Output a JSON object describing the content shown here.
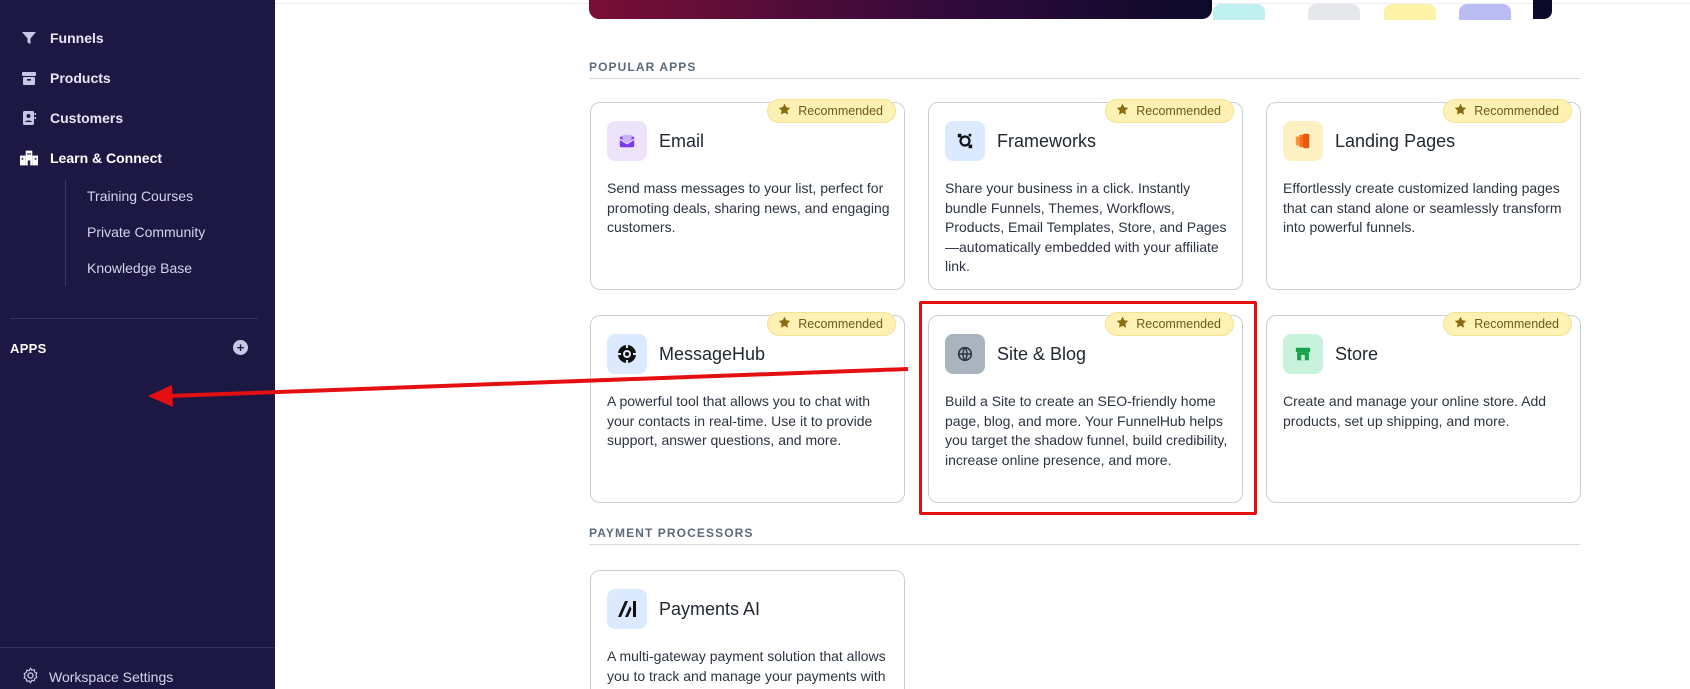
{
  "sidebar": {
    "nav": [
      {
        "label": "Funnels",
        "icon": "funnel-icon"
      },
      {
        "label": "Products",
        "icon": "box-icon"
      },
      {
        "label": "Customers",
        "icon": "contact-card-icon"
      },
      {
        "label": "Learn & Connect",
        "icon": "buildings-icon"
      }
    ],
    "sub_items": [
      "Training Courses",
      "Private Community",
      "Knowledge Base"
    ],
    "apps_label": "APPS",
    "settings_label": "Workspace Settings"
  },
  "sections": {
    "popular_title": "POPULAR APPS",
    "payment_title": "PAYMENT PROCESSORS"
  },
  "badge_label": "Recommended",
  "apps": [
    {
      "name": "Email",
      "desc": "Send mass messages to your list, perfect for promoting deals, sharing news, and engaging customers.",
      "icon": "email-icon",
      "icon_bg": "#ede4fb",
      "icon_color": "#7c3aed",
      "recommended": true
    },
    {
      "name": "Frameworks",
      "desc": "Share your business in a click. Instantly bundle Funnels, Themes, Workflows, Products, Email Templates, Store, and Pages—automatically embedded with your affiliate link.",
      "icon": "frameworks-icon",
      "icon_bg": "#dbeafe",
      "icon_color": "#111111",
      "recommended": true
    },
    {
      "name": "Landing Pages",
      "desc": "Effortlessly create customized landing pages that can stand alone or seamlessly transform into powerful funnels.",
      "icon": "landing-pages-icon",
      "icon_bg": "#fdf1c4",
      "icon_color": "#ea580c",
      "recommended": true
    },
    {
      "name": "MessageHub",
      "desc": "A powerful tool that allows you to chat with your contacts in real-time. Use it to provide support, answer questions, and more.",
      "icon": "message-hub-icon",
      "icon_bg": "#dbeafe",
      "icon_color": "#111111",
      "recommended": true
    },
    {
      "name": "Site & Blog",
      "desc": "Build a Site to create an SEO-friendly home page, blog, and more. Your FunnelHub helps you target the shadow funnel, build credibility, increase online presence, and more.",
      "icon": "globe-icon",
      "icon_bg": "#a9b4bf",
      "icon_color": "#2a3340",
      "recommended": true
    },
    {
      "name": "Store",
      "desc": "Create and manage your online store. Add products, set up shipping, and more.",
      "icon": "store-icon",
      "icon_bg": "#c9f2dc",
      "icon_color": "#16a34a",
      "recommended": true
    }
  ],
  "payment_apps": [
    {
      "name": "Payments AI",
      "desc": "A multi-gateway payment solution that allows you to track and manage your payments with",
      "icon": "payments-ai-icon",
      "icon_bg": "#dbeafe",
      "icon_color": "#111111"
    }
  ]
}
